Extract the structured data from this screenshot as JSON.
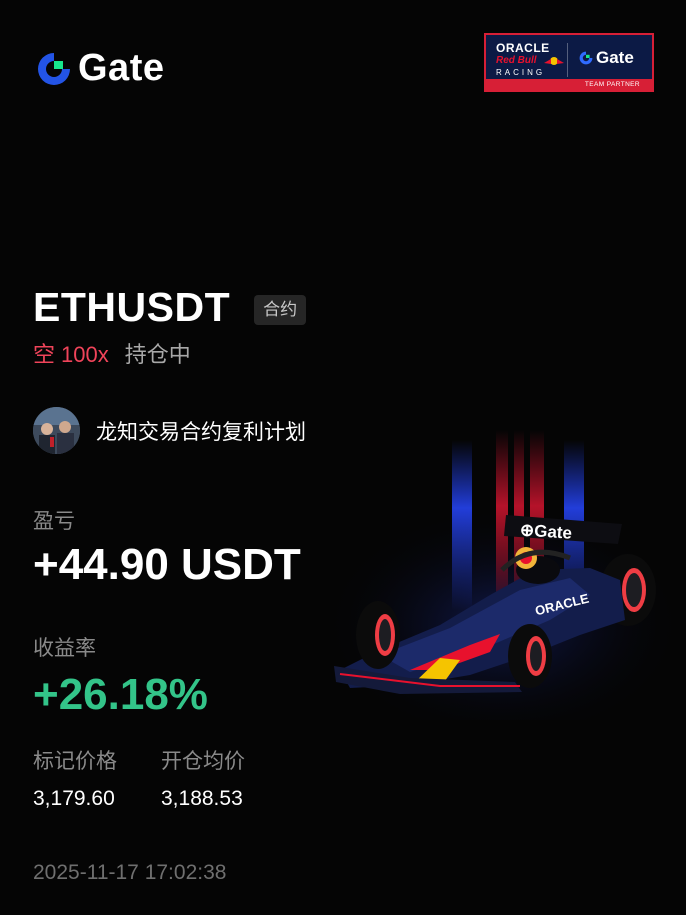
{
  "brand": {
    "name": "Gate",
    "accent": "#2354e6",
    "accent_green": "#17e68c"
  },
  "partner": {
    "oracle": "ORACLE",
    "red_bull": "Red Bull",
    "racing": "RACING",
    "gate": "Gate",
    "footer": "TEAM PARTNER"
  },
  "position": {
    "pair": "ETHUSDT",
    "contract_tag": "合约",
    "side": "空",
    "leverage": "100x",
    "status": "持仓中"
  },
  "strategy": {
    "name": "龙知交易合约复利计划"
  },
  "pnl": {
    "label": "盈亏",
    "value": "+44.90 USDT"
  },
  "roi": {
    "label": "收益率",
    "value": "+26.18%"
  },
  "prices": {
    "mark_label": "标记价格",
    "mark_value": "3,179.60",
    "entry_label": "开仓均价",
    "entry_value": "3,188.53"
  },
  "timestamp": "2025-11-17 17:02:38",
  "colors": {
    "short": "#f0445a",
    "profit": "#33c489",
    "muted": "#8a8a8a"
  }
}
